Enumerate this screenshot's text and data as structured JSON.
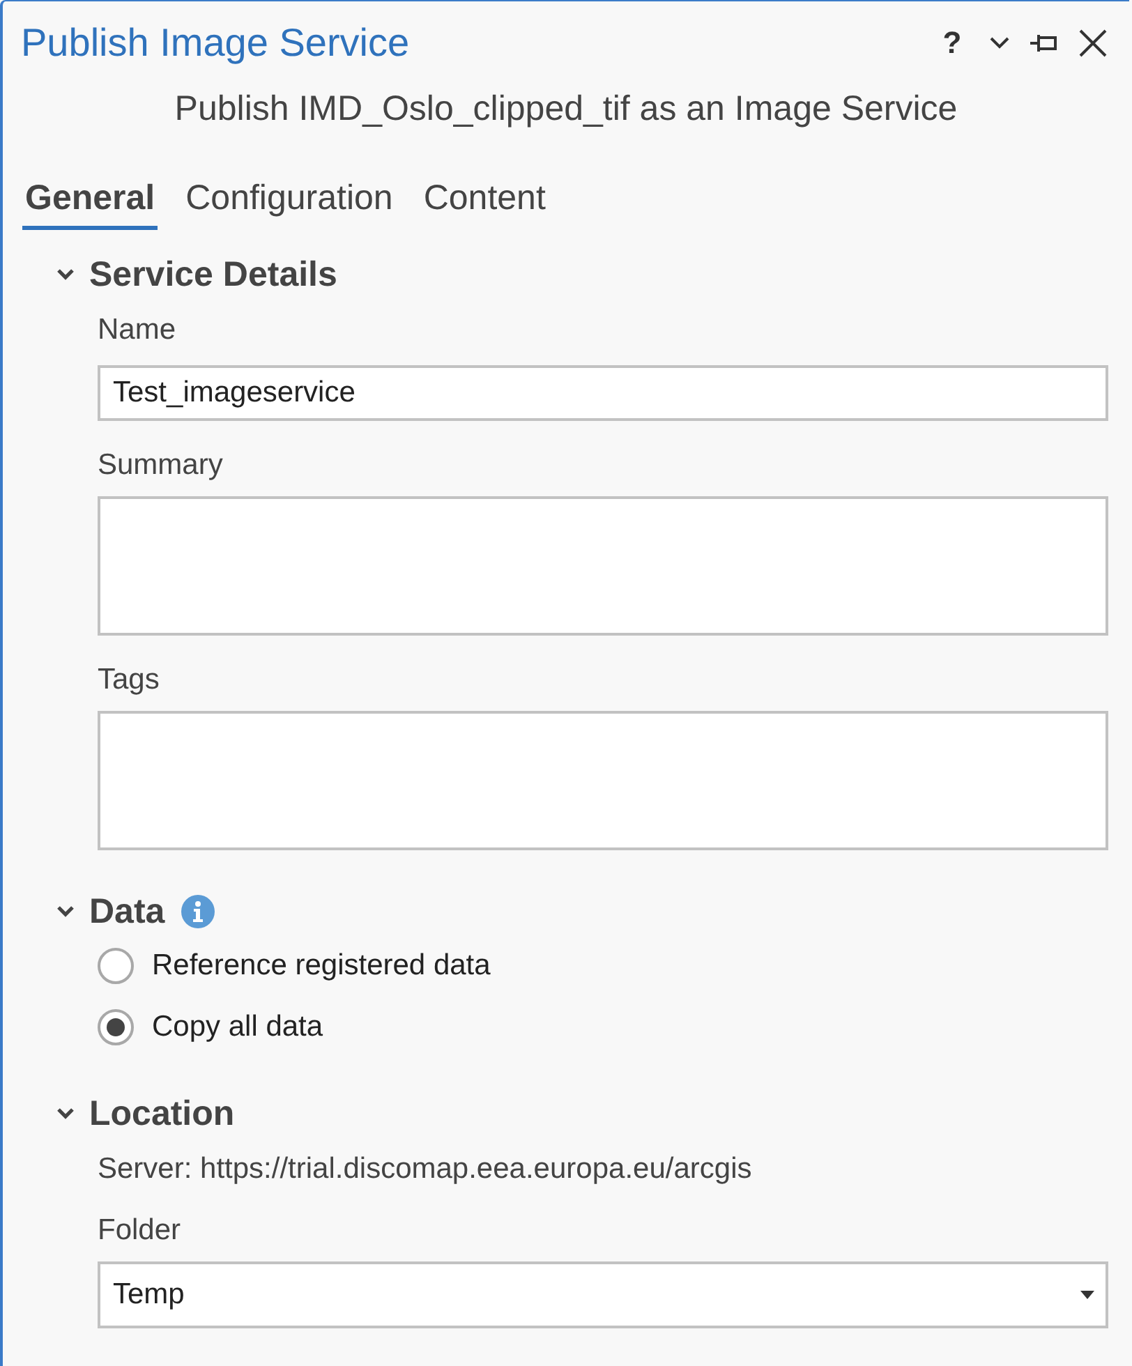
{
  "window": {
    "title": "Publish Image Service",
    "help": "?"
  },
  "heading": "Publish IMD_Oslo_clipped_tif as an Image Service",
  "tabs": [
    {
      "label": "General",
      "selected": true
    },
    {
      "label": "Configuration",
      "selected": false
    },
    {
      "label": "Content",
      "selected": false
    }
  ],
  "sections": [
    {
      "title": "Service Details",
      "expanded": true,
      "fields": [
        {
          "kind": "text",
          "label": "Name",
          "value": "Test_imageservice"
        },
        {
          "kind": "textarea",
          "label": "Summary"
        },
        {
          "kind": "textarea",
          "label": "Tags"
        }
      ]
    },
    {
      "title": "Data",
      "expanded": true,
      "info": true,
      "options": [
        {
          "label": "Reference registered data",
          "selected": false
        },
        {
          "label": "Copy all data",
          "selected": true
        }
      ]
    },
    {
      "title": "Location",
      "expanded": true,
      "server": "Server: https://trial.discomap.eea.europa.eu/arcgis",
      "fields": [
        {
          "kind": "dropdown",
          "label": "Folder",
          "value": "Temp"
        }
      ]
    }
  ]
}
